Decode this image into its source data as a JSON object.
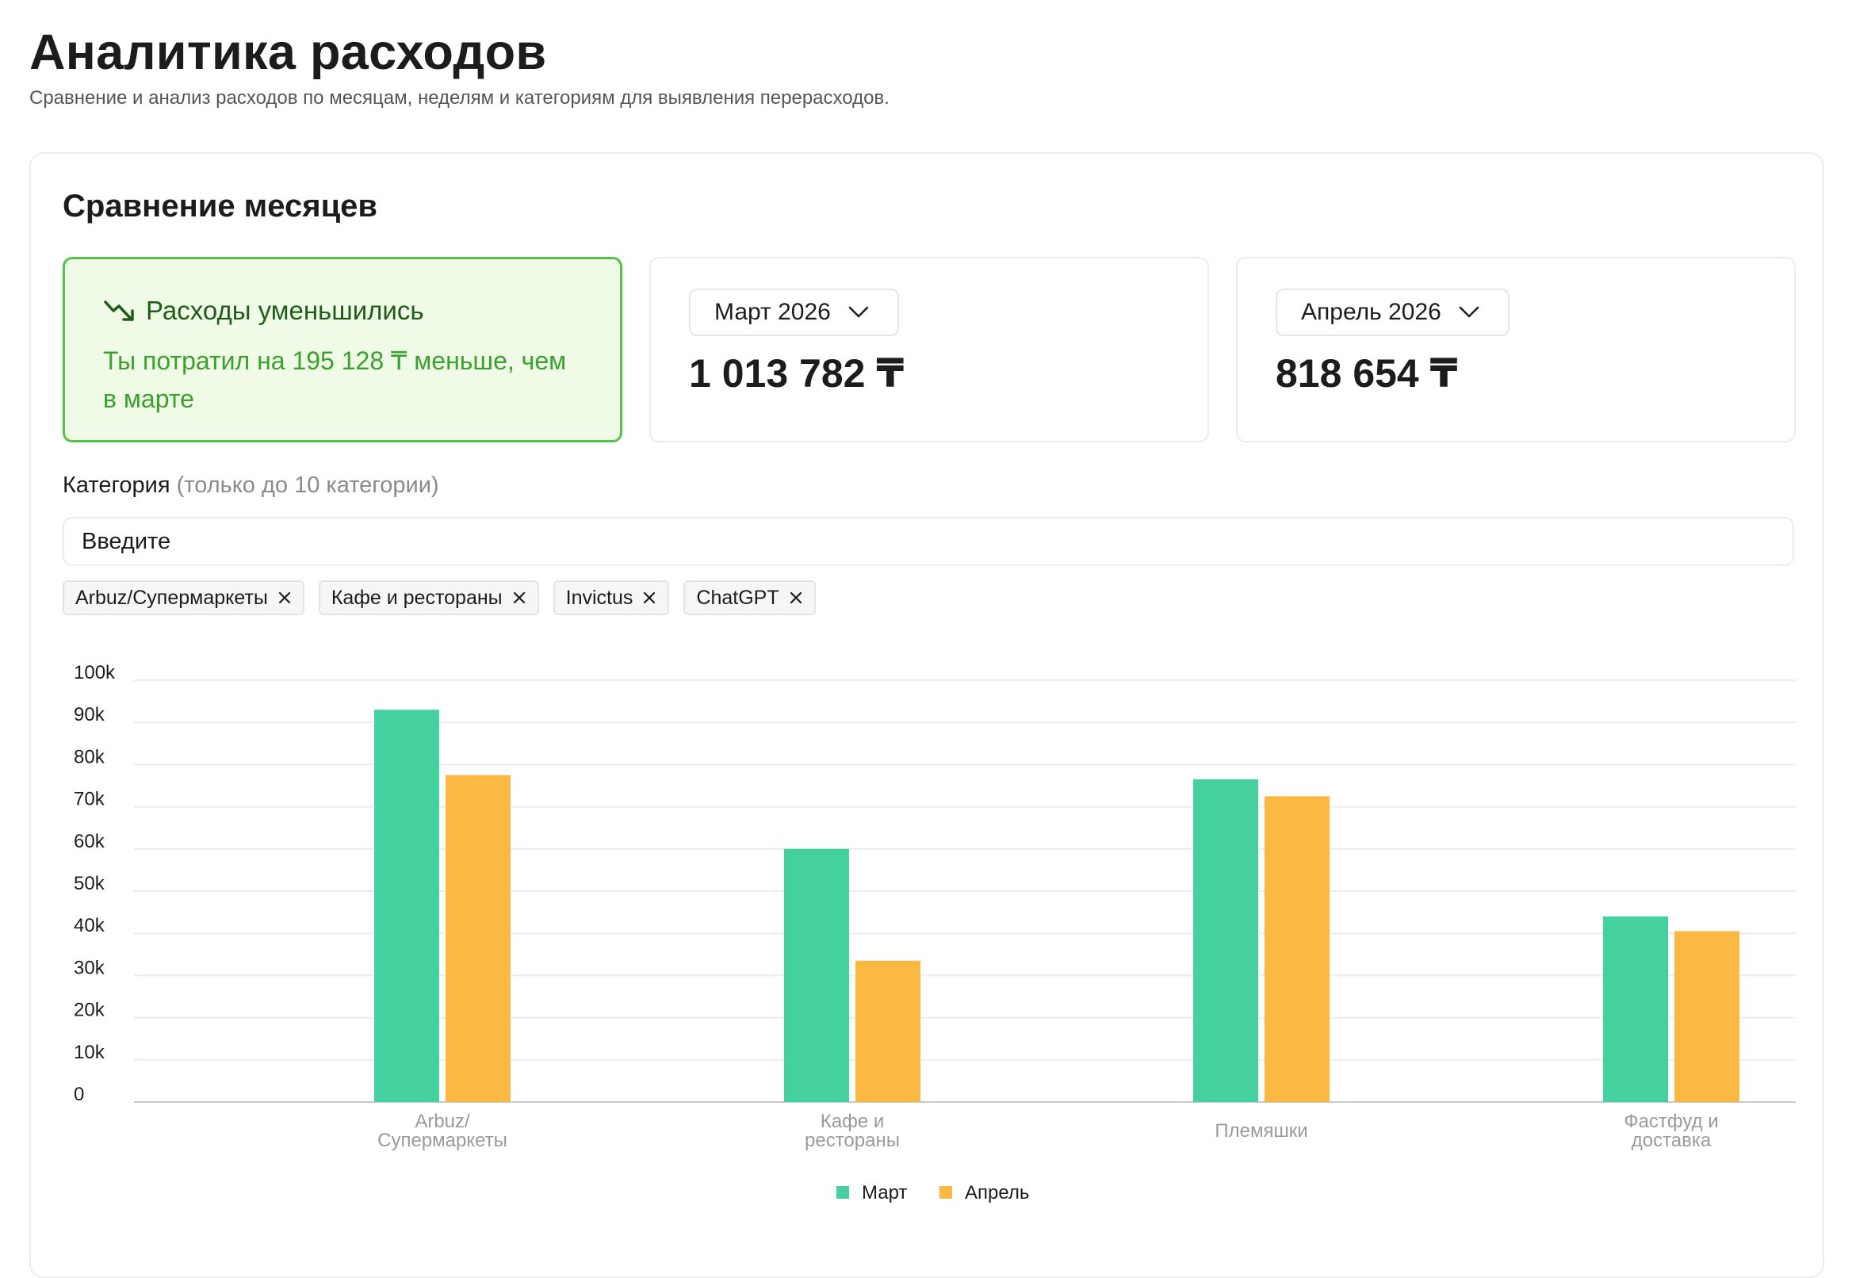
{
  "page": {
    "title": "Аналитика расходов",
    "subtitle": "Сравнение и анализ расходов по месяцам, неделям и категориям для выявления перерасходов."
  },
  "comparison": {
    "section_title": "Сравнение месяцев",
    "change": {
      "icon": "trending-down-icon",
      "title": "Расходы уменьшились",
      "text": "Ты потратил на 195 128 ₸ меньше, чем в марте"
    },
    "month_a": {
      "label": "Март 2026",
      "amount": "1 013 782 ₸"
    },
    "month_b": {
      "label": "Апрель 2026",
      "amount": "818 654 ₸"
    }
  },
  "category_filter": {
    "label": "Категория",
    "hint": "(только до 10 категории)",
    "placeholder": "Введите",
    "chips": [
      {
        "label": "Arbuz/Супермаркеты"
      },
      {
        "label": "Кафе и рестораны"
      },
      {
        "label": "Invictus"
      },
      {
        "label": "ChatGPT"
      }
    ]
  },
  "colors": {
    "march": "#45d19e",
    "april": "#fbb944",
    "change_green": "#3aa02e"
  },
  "chart_data": {
    "type": "bar",
    "categories": [
      [
        "Arbuz/",
        "Супермаркеты"
      ],
      [
        "Кафе и",
        "рестораны"
      ],
      [
        "Племяшки"
      ],
      [
        "Фастфуд и",
        "доставка"
      ]
    ],
    "series": [
      {
        "name": "Март",
        "values": [
          93000,
          60000,
          76500,
          44000
        ]
      },
      {
        "name": "Апрель",
        "values": [
          77500,
          33500,
          72500,
          40500
        ]
      }
    ],
    "ylim": [
      0,
      100000
    ],
    "yticks": [
      {
        "value": 0,
        "label": "0"
      },
      {
        "value": 10000,
        "label": "10k"
      },
      {
        "value": 20000,
        "label": "20k"
      },
      {
        "value": 30000,
        "label": "30k"
      },
      {
        "value": 40000,
        "label": "40k"
      },
      {
        "value": 50000,
        "label": "50k"
      },
      {
        "value": 60000,
        "label": "60k"
      },
      {
        "value": 70000,
        "label": "70k"
      },
      {
        "value": 80000,
        "label": "80k"
      },
      {
        "value": 90000,
        "label": "90k"
      },
      {
        "value": 100000,
        "label": "100k"
      }
    ],
    "grid": true,
    "legend_position": "bottom"
  }
}
